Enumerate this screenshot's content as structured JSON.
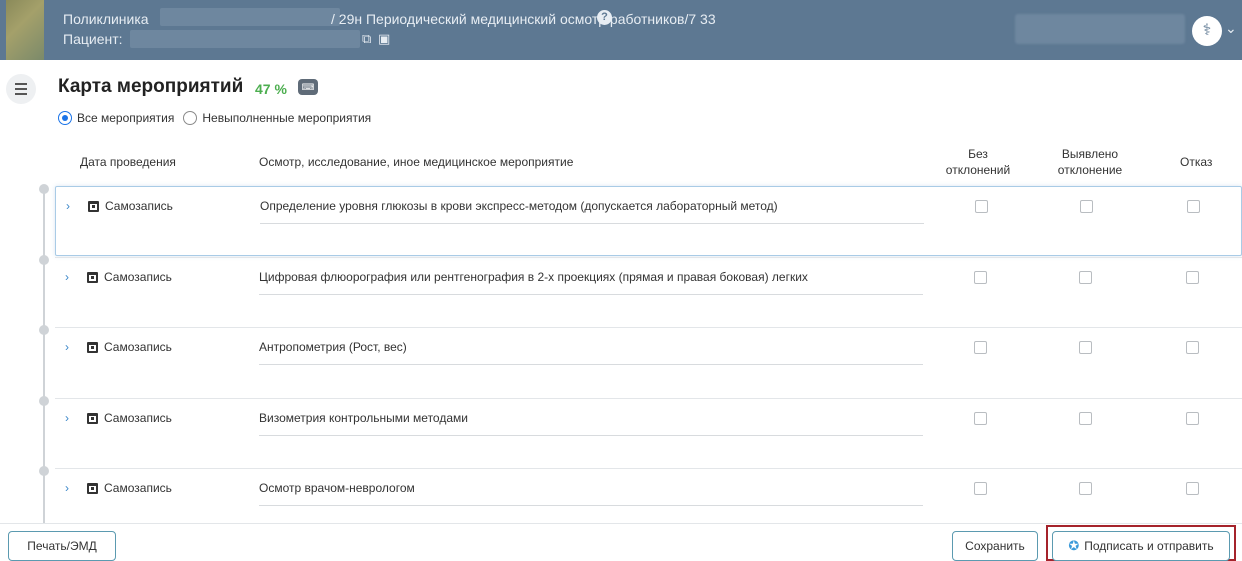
{
  "header": {
    "clinic_label": "Поликлиника",
    "document_title": "/ 29н Периодический медицинский осмотр работников/7  33",
    "patient_label": "Пациент:"
  },
  "page": {
    "title": "Карта мероприятий",
    "percent": "47 %"
  },
  "filters": {
    "all_label": "Все мероприятия",
    "incomplete_label": "Невыполненные мероприятия",
    "selected": "all"
  },
  "table": {
    "col_date": "Дата проведения",
    "col_event": "Осмотр, исследование, иное медицинское мероприятие",
    "col_normal": [
      "Без",
      "отклонений"
    ],
    "col_deviation": [
      "Выявлено",
      "отклонение"
    ],
    "col_refusal": "Отказ",
    "rows": [
      {
        "date": "Самозапись",
        "service": "Определение уровня глюкозы в крови экспресс-методом (допускается лабораторный метод)"
      },
      {
        "date": "Самозапись",
        "service": "Цифровая флюорография или рентгенография в 2-х проекциях (прямая и правая боковая) легких"
      },
      {
        "date": "Самозапись",
        "service": "Антропометрия (Рост, вес)"
      },
      {
        "date": "Самозапись",
        "service": "Визометрия контрольными методами"
      },
      {
        "date": "Самозапись",
        "service": "Осмотр врачом-неврологом"
      }
    ]
  },
  "footer": {
    "print_label": "Печать/ЭМД",
    "save_label": "Сохранить",
    "sign_label": "Подписать и отправить"
  },
  "colors": {
    "header_bg": "#5d7892",
    "accent": "#1a73e8",
    "percent_green": "#4cae4f",
    "highlight_red": "#a5232b"
  }
}
